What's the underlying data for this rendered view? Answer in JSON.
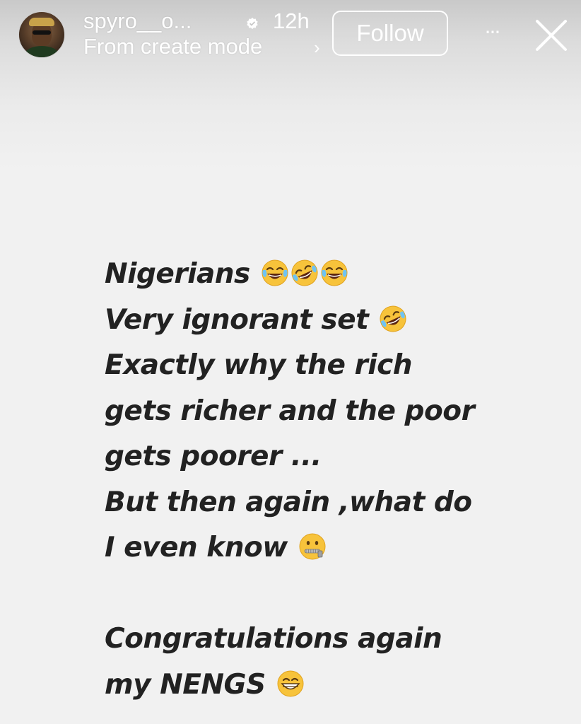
{
  "header": {
    "username": "spyro__o...",
    "time": "12h",
    "subtitle": "From create mode",
    "chevron": "›",
    "follow_label": "Follow",
    "more_label": "···",
    "avatar_icon": "profile-photo",
    "verified_icon": "verified-badge-icon",
    "close_icon": "close-icon"
  },
  "story": {
    "background": "#f1f1f1",
    "text_color": "#222222",
    "lines": [
      {
        "text": "Nigerians",
        "emojis": [
          "laugh-cry",
          "rolling-laugh",
          "laugh-cry"
        ]
      },
      {
        "text": "Very ignorant set",
        "emojis": [
          "rolling-laugh"
        ]
      },
      {
        "text": "Exactly why the rich",
        "emojis": []
      },
      {
        "text": "gets richer and the poor",
        "emojis": []
      },
      {
        "text": "gets poorer ...",
        "emojis": []
      },
      {
        "text": "But then again ,what do",
        "emojis": []
      },
      {
        "text": "I even know",
        "emojis": [
          "zipper-mouth"
        ]
      },
      {
        "text": "",
        "emojis": []
      },
      {
        "text": "Congratulations again",
        "emojis": []
      },
      {
        "text": "my NENGS",
        "emojis": [
          "grinning"
        ]
      }
    ]
  }
}
